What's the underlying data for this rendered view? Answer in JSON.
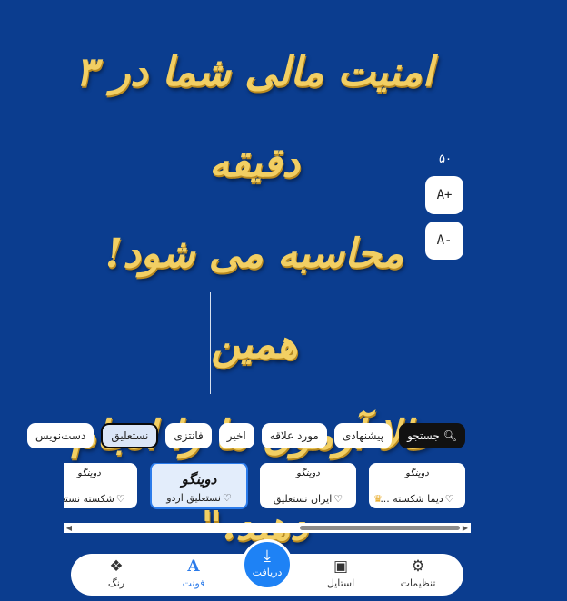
{
  "canvas": {
    "headline_lines": [
      "امنیت مالی شما در ۳ دقیقه",
      "محاسبه می شود! همین",
      "حالا آزمون ما را انجام",
      "دهید.\""
    ]
  },
  "size_controls": {
    "value": "۵۰",
    "increase_label": "A+",
    "decrease_label": "A-"
  },
  "filters": [
    {
      "label": "جستجو",
      "icon": "search-icon",
      "type": "search"
    },
    {
      "label": "پیشنهادی"
    },
    {
      "label": "مورد علاقه"
    },
    {
      "label": "اخیر"
    },
    {
      "label": "فانتزی"
    },
    {
      "label": "نستعلیق",
      "active": true
    },
    {
      "label": "دست‌نویس"
    }
  ],
  "font_cards": [
    {
      "sample": "دوینگو",
      "name": "دیما شکسته ...",
      "crown": true
    },
    {
      "sample": "دوینگو",
      "name": "ایران نستعلیق"
    },
    {
      "sample": "دوینگو",
      "name": "نستعلیق اردو",
      "selected": true
    },
    {
      "sample": "دوینگو",
      "name": "شکسته نستعل"
    }
  ],
  "nav": {
    "settings": "تنظیمات",
    "style": "استایل",
    "download": "دریافت",
    "font": "فونت",
    "color": "رنگ"
  },
  "colors": {
    "background": "#0b3d8f",
    "headline": "#f2cf63",
    "accent": "#1e82f5"
  }
}
